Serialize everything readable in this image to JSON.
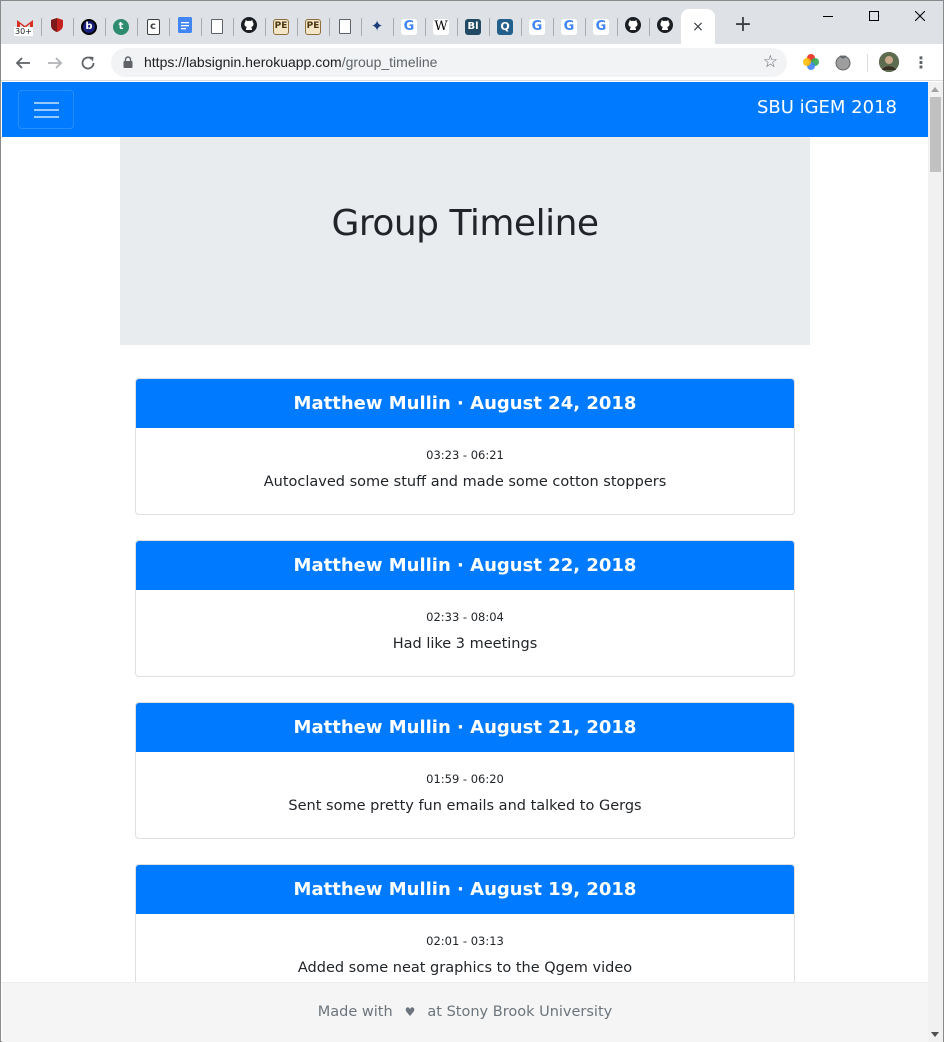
{
  "browser": {
    "tabs": [
      {
        "icon": "gmail-icon",
        "badge": "30+",
        "color": "#d93025"
      },
      {
        "icon": "shield-icon",
        "color": "#c5221f"
      },
      {
        "icon": "b-circle-icon",
        "letter": "b",
        "color": "#1a237e"
      },
      {
        "icon": "t-circle-icon",
        "letter": "t",
        "color": "#2e8b6e"
      },
      {
        "icon": "doc-c-icon",
        "letter": "c",
        "color": "#5f6368"
      },
      {
        "icon": "google-docs-icon",
        "color": "#4285f4"
      },
      {
        "icon": "blank-page-icon"
      },
      {
        "icon": "github-icon"
      },
      {
        "icon": "pe-icon",
        "letter": "PE",
        "color": "#8d6e3a"
      },
      {
        "icon": "pe-icon",
        "letter": "PE",
        "color": "#8d6e3a"
      },
      {
        "icon": "blank-page-icon"
      },
      {
        "icon": "sparkle-icon",
        "letter": "✦",
        "color": "#1a3d7c"
      },
      {
        "icon": "google-icon",
        "letter": "G"
      },
      {
        "icon": "wikipedia-icon",
        "letter": "W",
        "color": "#000000"
      },
      {
        "icon": "bl-icon",
        "letter": "Bl",
        "color": "#234a63"
      },
      {
        "icon": "q-icon",
        "letter": "Q",
        "color": "#23608c"
      },
      {
        "icon": "google-icon",
        "letter": "G"
      },
      {
        "icon": "google-icon",
        "letter": "G"
      },
      {
        "icon": "google-icon",
        "letter": "G"
      },
      {
        "icon": "github-icon"
      },
      {
        "icon": "github-icon"
      }
    ],
    "active_tab_close": "×",
    "new_tab": "+",
    "url_host": "https://labsignin.herokuapp.com",
    "url_path": "/group_timeline"
  },
  "navbar": {
    "brand": "SBU iGEM 2018",
    "color": "#007bff"
  },
  "page": {
    "title": "Group Timeline"
  },
  "entries": [
    {
      "header": "Matthew Mullin · August 24, 2018",
      "time": "03:23 - 06:21",
      "description": "Autoclaved some stuff and made some cotton stoppers"
    },
    {
      "header": "Matthew Mullin · August 22, 2018",
      "time": "02:33 - 08:04",
      "description": "Had like 3 meetings"
    },
    {
      "header": "Matthew Mullin · August 21, 2018",
      "time": "01:59 - 06:20",
      "description": "Sent some pretty fun emails and talked to Gergs"
    },
    {
      "header": "Matthew Mullin · August 19, 2018",
      "time": "02:01 - 03:13",
      "description": "Added some neat graphics to the Qgem video"
    }
  ],
  "footer": {
    "before": "Made with",
    "heart": "♥",
    "after": "at Stony Brook University"
  }
}
